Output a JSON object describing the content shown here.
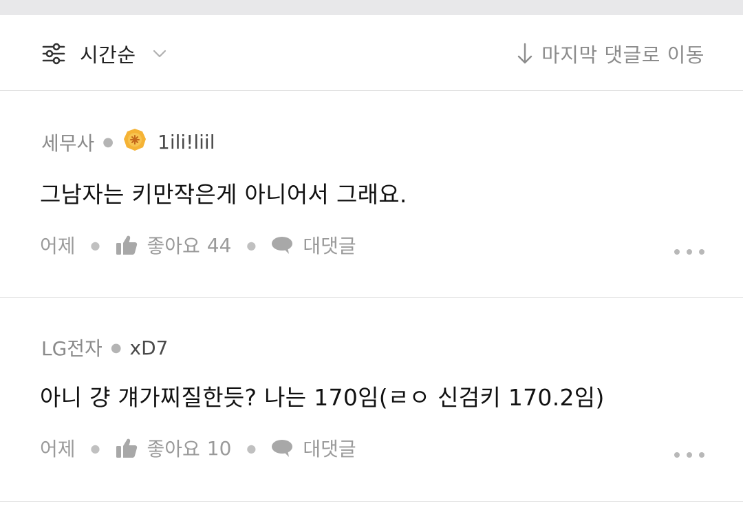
{
  "sort": {
    "label": "시간순",
    "icon": "filter-sliders-icon",
    "chevron": "chevron-down-icon"
  },
  "jump": {
    "label": "마지막 댓글로 이동",
    "icon": "arrow-down-icon"
  },
  "comments": [
    {
      "company": "세무사",
      "badge_icon": "gold-badge-icon",
      "nickname": "1ili!liil",
      "text": "그남자는 키만작은게 아니어서 그래요.",
      "time": "어제",
      "like_label": "좋아요",
      "like_count": "44",
      "reply_label": "대댓글"
    },
    {
      "company": "LG전자",
      "nickname": "xD7",
      "text": "아니 걍 걔가찌질한듯? 나는 170임(ㄹㅇ 신검키 170.2임)",
      "time": "어제",
      "like_label": "좋아요",
      "like_count": "10",
      "reply_label": "대댓글"
    }
  ],
  "colors": {
    "badge": "#F5B335",
    "muted": "#9A9A9A",
    "divider": "#E3E3E3",
    "top_strip": "#E8E8EA"
  }
}
